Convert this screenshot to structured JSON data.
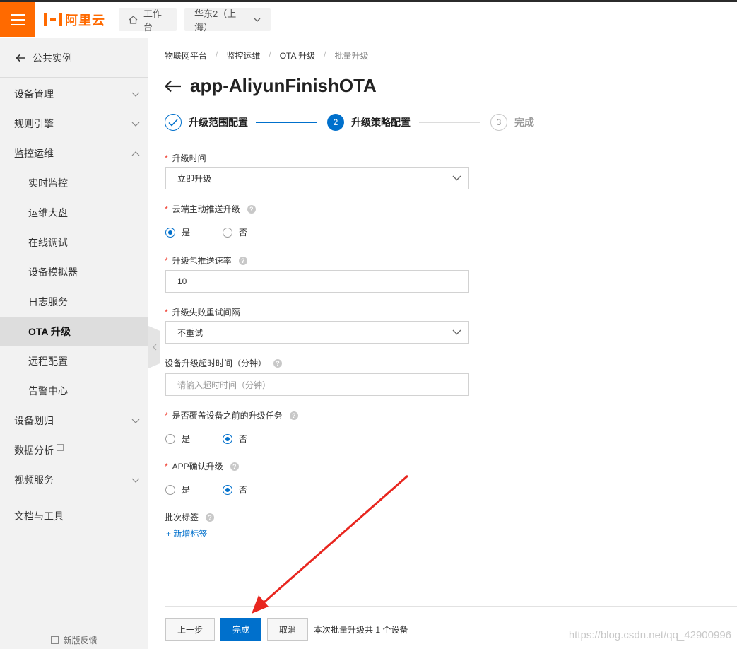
{
  "brand": {
    "logo_text": "阿里云",
    "accent": "#ff6a00"
  },
  "topbar": {
    "workbench": "工作台",
    "region": "华东2（上海）"
  },
  "sidebar": {
    "back_label": "公共实例",
    "items": [
      {
        "label": "设备管理",
        "chevron": "down"
      },
      {
        "label": "规则引擎",
        "chevron": "down"
      },
      {
        "label": "监控运维",
        "chevron": "up"
      },
      {
        "label": "实时监控"
      },
      {
        "label": "运维大盘"
      },
      {
        "label": "在线调试"
      },
      {
        "label": "设备模拟器"
      },
      {
        "label": "日志服务"
      },
      {
        "label": "OTA 升级",
        "active": true
      },
      {
        "label": "远程配置"
      },
      {
        "label": "告警中心"
      },
      {
        "label": "设备划归",
        "chevron": "down"
      },
      {
        "label": "数据分析"
      },
      {
        "label": "视频服务",
        "chevron": "down"
      },
      {
        "label": "文档与工具"
      }
    ],
    "feedback": "新版反馈"
  },
  "breadcrumb": [
    "物联网平台",
    "监控运维",
    "OTA 升级",
    "批量升级"
  ],
  "page_title": "app-AliyunFinishOTA",
  "steps": [
    {
      "label": "升级范围配置",
      "state": "done"
    },
    {
      "num": "2",
      "label": "升级策略配置",
      "state": "current"
    },
    {
      "num": "3",
      "label": "完成",
      "state": "todo"
    }
  ],
  "form": {
    "upgrade_time": {
      "label": "升级时间",
      "value": "立即升级"
    },
    "cloud_push": {
      "label": "云端主动推送升级",
      "options": [
        "是",
        "否"
      ],
      "selected": 0
    },
    "push_rate": {
      "label": "升级包推送速率",
      "value": "10"
    },
    "retry_interval": {
      "label": "升级失败重试间隔",
      "value": "不重试"
    },
    "timeout": {
      "label": "设备升级超时时间（分钟）",
      "placeholder": "请输入超时时间（分钟）"
    },
    "overwrite": {
      "label": "是否覆盖设备之前的升级任务",
      "options": [
        "是",
        "否"
      ],
      "selected": 1
    },
    "app_confirm": {
      "label": "APP确认升级",
      "options": [
        "是",
        "否"
      ],
      "selected": 1
    },
    "batch_tag": {
      "label": "批次标签",
      "add_label": "+ 新增标签"
    }
  },
  "footer": {
    "prev": "上一步",
    "finish": "完成",
    "cancel": "取消",
    "summary": "本次批量升级共 1 个设备"
  },
  "watermark": "https://blog.csdn.net/qq_42900996",
  "colors": {
    "primary": "#0070cc",
    "annotation_arrow": "#e8261f"
  }
}
